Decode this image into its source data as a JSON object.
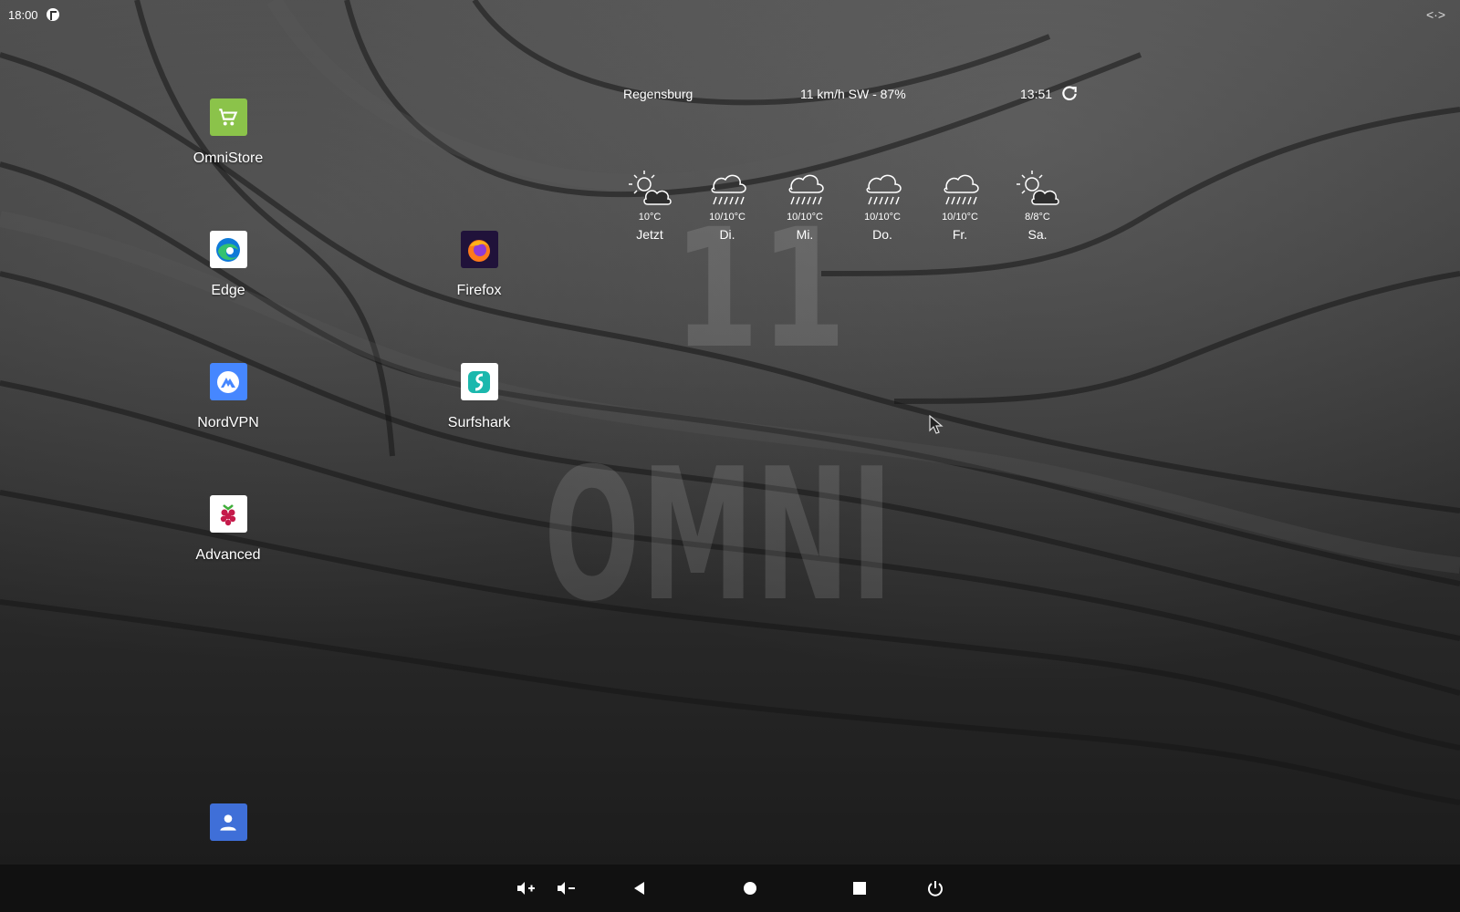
{
  "status_bar": {
    "time": "18:00",
    "app_icon": "omni-status-icon",
    "expand_icon": "expand-arrows-icon",
    "expand_glyph": "<·>"
  },
  "wallpaper": {
    "watermark_top": "11",
    "watermark_bottom": "OMNI"
  },
  "desktop_apps": [
    {
      "label": "OmniStore",
      "icon": "shopping-cart-icon",
      "color": "#8bc34a"
    },
    {
      "label": "Edge",
      "icon": "edge-browser-icon",
      "color": "#ffffff"
    },
    {
      "label": "Firefox",
      "icon": "firefox-icon",
      "color": "#20123a"
    },
    {
      "label": "NordVPN",
      "icon": "nordvpn-icon",
      "color": "#4687ff"
    },
    {
      "label": "Surfshark",
      "icon": "surfshark-icon",
      "color": "#ffffff"
    },
    {
      "label": "Advanced",
      "icon": "raspberry-pi-icon",
      "color": "#ffffff"
    },
    {
      "label": "",
      "icon": "contacts-icon",
      "color": "#3f6fd8"
    }
  ],
  "weather": {
    "city": "Regensburg",
    "wind": "11 km/h SW - 87%",
    "updated": "13:51",
    "refresh_icon": "refresh-icon",
    "forecast": [
      {
        "temp": "10°C",
        "day": "Jetzt",
        "icon": "partly-sunny-icon"
      },
      {
        "temp": "10/10°C",
        "day": "Di.",
        "icon": "rain-cloud-icon"
      },
      {
        "temp": "10/10°C",
        "day": "Mi.",
        "icon": "rain-cloud-icon"
      },
      {
        "temp": "10/10°C",
        "day": "Do.",
        "icon": "rain-cloud-icon"
      },
      {
        "temp": "10/10°C",
        "day": "Fr.",
        "icon": "rain-cloud-icon"
      },
      {
        "temp": "8/8°C",
        "day": "Sa.",
        "icon": "partly-sunny-icon"
      }
    ]
  },
  "nav_bar": {
    "buttons": [
      "volume-up-icon",
      "volume-down-icon",
      "back-icon",
      "home-icon",
      "recents-icon",
      "power-icon"
    ]
  },
  "colors": {
    "nav_background": "#111111",
    "text": "#ffffff"
  }
}
